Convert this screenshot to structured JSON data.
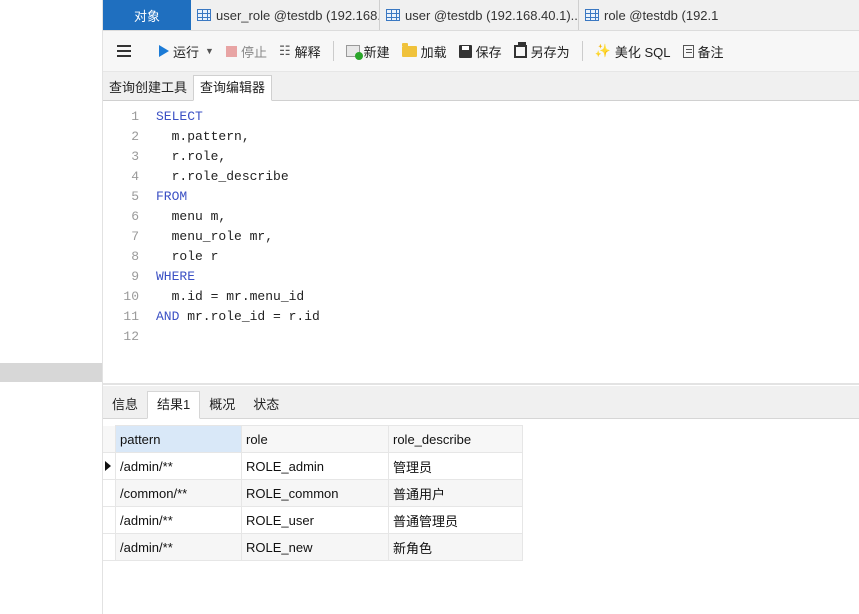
{
  "tabs": [
    {
      "label": "对象"
    },
    {
      "label": "user_role @testdb (192.168...."
    },
    {
      "label": "user @testdb (192.168.40.1)..."
    },
    {
      "label": "role @testdb (192.1"
    }
  ],
  "toolbar": {
    "run": "运行",
    "stop": "停止",
    "explain": "解释",
    "new": "新建",
    "load": "加载",
    "save": "保存",
    "save_as": "另存为",
    "beautify": "美化 SQL",
    "memo": "备注"
  },
  "subtabs": {
    "builder": "查询创建工具",
    "editor": "查询编辑器"
  },
  "sql_lines": [
    {
      "n": "1",
      "kw": "SELECT",
      "tx": ""
    },
    {
      "n": "2",
      "kw": "",
      "tx": "  m.pattern,"
    },
    {
      "n": "3",
      "kw": "",
      "tx": "  r.role,"
    },
    {
      "n": "4",
      "kw": "",
      "tx": "  r.role_describe"
    },
    {
      "n": "5",
      "kw": "FROM",
      "tx": ""
    },
    {
      "n": "6",
      "kw": "",
      "tx": "  menu m,"
    },
    {
      "n": "7",
      "kw": "",
      "tx": "  menu_role mr,"
    },
    {
      "n": "8",
      "kw": "",
      "tx": "  role r"
    },
    {
      "n": "9",
      "kw": "WHERE",
      "tx": ""
    },
    {
      "n": "10",
      "kw": "",
      "tx": "  m.id = mr.menu_id"
    },
    {
      "n": "11",
      "kw": "AND",
      "tx": " mr.role_id = r.id"
    },
    {
      "n": "12",
      "kw": "",
      "tx": ""
    }
  ],
  "result_tabs": {
    "info": "信息",
    "result1": "结果1",
    "overview": "概况",
    "status": "状态"
  },
  "grid": {
    "columns": [
      "pattern",
      "role",
      "role_describe"
    ],
    "rows": [
      [
        "/admin/**",
        "ROLE_admin",
        "管理员"
      ],
      [
        "/common/**",
        "ROLE_common",
        "普通用户"
      ],
      [
        "/admin/**",
        "ROLE_user",
        "普通管理员"
      ],
      [
        "/admin/**",
        "ROLE_new",
        "新角色"
      ]
    ]
  }
}
